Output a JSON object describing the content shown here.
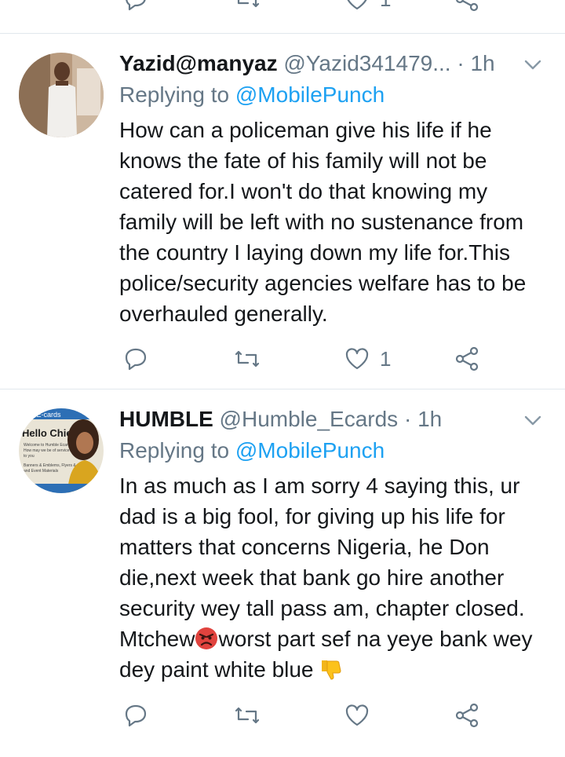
{
  "top_actions": {
    "like_count": "1"
  },
  "tweets": [
    {
      "name": "Yazid@manyaz",
      "handle": "@Yazid341479...",
      "dot": "·",
      "time": "1h",
      "replying_prefix": "Replying to",
      "replying_to": "@MobilePunch",
      "text": "How can a policeman give his life if he knows the fate of his family will not be catered for.I won't do that knowing my family will be left with no sustenance from the country I laying down my life for.This police/security agencies welfare has to be overhauled generally.",
      "like_count": "1"
    },
    {
      "name": "HUMBLE",
      "handle": "@Humble_Ecards",
      "dot": "·",
      "time": "1h",
      "replying_prefix": "Replying to",
      "replying_to": "@MobilePunch",
      "text_part1": "In as much as I am sorry 4 saying this, ur dad is a big fool, for giving up his life for matters that concerns Nigeria, he Don die,next week that bank go hire another security wey tall pass am,  chapter closed.  Mtchew",
      "text_part2": "worst part sef na yeye bank wey dey paint white blue ",
      "avatar_text": {
        "brand": "ole E-cards",
        "headline": "Hello Chief,",
        "line1": "Welcome to Humble Ecards",
        "line2": "How may we be of service",
        "line3": "to you",
        "line4": "Banners & Emblems, Flyers & Cards",
        "line5": "and Event Materials"
      },
      "like_count": ""
    }
  ]
}
